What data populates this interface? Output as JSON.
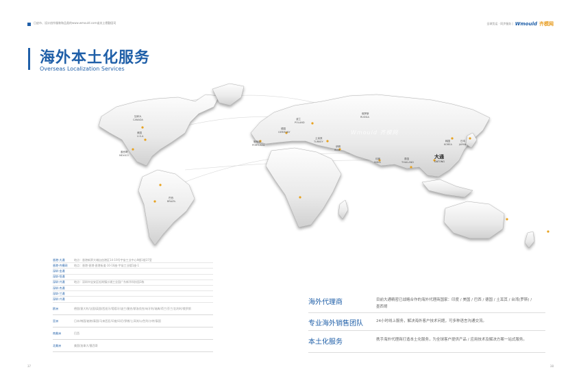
{
  "header": {
    "tagline": "日皮市、设计创作服装和品类的www.wmould.com省关土德勤园司",
    "slogan": "全球货运 · 同步服务 |",
    "logo_text": "Wmould",
    "logo_cn": "齐模网"
  },
  "title": {
    "cn": "海外本土化服务",
    "en": "Overseas Localization Services"
  },
  "map": {
    "watermark": "Wmould 齐模网",
    "labels": {
      "canada": "加拿大",
      "canada_en": "CANADA",
      "usa": "美国",
      "usa_en": "U.S.A",
      "mexico": "墨西哥",
      "mexico_en": "MEXICO",
      "brazil": "巴西",
      "brazil_en": "BRAZIL",
      "russia": "俄罗斯",
      "russia_en": "RUSSIA",
      "germany": "德国",
      "germany_en": "GERMANY",
      "poland": "波兰",
      "poland_en": "POLAND",
      "portugal": "葡萄牙",
      "portugal_en": "PORTUGAL",
      "turkey": "土耳其",
      "turkey_en": "TURKEY",
      "iran": "伊朗",
      "iran_en": "IRAN",
      "india": "印度",
      "india_en": "INDIA",
      "thailand": "泰国",
      "thailand_en": "THAILAND",
      "korea": "韩国",
      "korea_en": "KOREA",
      "japan": "日本",
      "japan_en": "JAPAN",
      "datong": "大通",
      "datong_en": "DATONG"
    }
  },
  "addresses": [
    {
      "city": "香港-大通",
      "text": "地点：香港新界大埔自由港区14-19号宇宙工业中心9楼1楼37室"
    },
    {
      "city": "香港-齐模网",
      "text": "地点：香港·香港·香港街道·10-16座·宇宙工业楼1座·1"
    },
    {
      "city": "深圳-金通",
      "text": ""
    },
    {
      "city": "深圳-恒通",
      "text": ""
    },
    {
      "city": "深圳-兴通",
      "text": "地点：深圳市宝安区松岗镇沙浦工业园广东新华科技园3栋"
    },
    {
      "city": "深圳-杰通",
      "text": ""
    },
    {
      "city": "深圳-兰通",
      "text": ""
    },
    {
      "city": "深圳-兴通",
      "text": ""
    }
  ],
  "regions": [
    {
      "name": "欧洲",
      "list": "德国/意大利/法国/英国/西班牙/葡萄牙/波兰/捷克/斯洛伐克/匈牙利/瑞典/荷兰/芬兰/比利时/俄罗斯"
    },
    {
      "name": "亚洲",
      "list": "日本/韩国/越南/泰国/马来西亚/印度/印尼/伊朗/土耳其/以色列/沙特/泰国"
    },
    {
      "name": "南美洲",
      "list": "巴西"
    },
    {
      "name": "北美洲",
      "list": "美国/加拿大/墨西哥"
    }
  ],
  "services": [
    {
      "name": "海外代理商",
      "desc": "目前大通精密已战略合作的海外代理商国家：印度 / 美国 / 巴西 / 德国 / 土耳其 / 台湾(罗斯) / 墨西哥"
    },
    {
      "name": "专业海外销售团队",
      "desc": "24小时线上服务，解决海外客户技术问题，可多种语言沟通交流。"
    },
    {
      "name": "本土化服务",
      "desc": "携手海外代理商打造本土化服务，为全球客户提供产品 / 应用技术及解决方案一站式服务。"
    }
  ],
  "pages": {
    "left": "37",
    "right": "38"
  }
}
